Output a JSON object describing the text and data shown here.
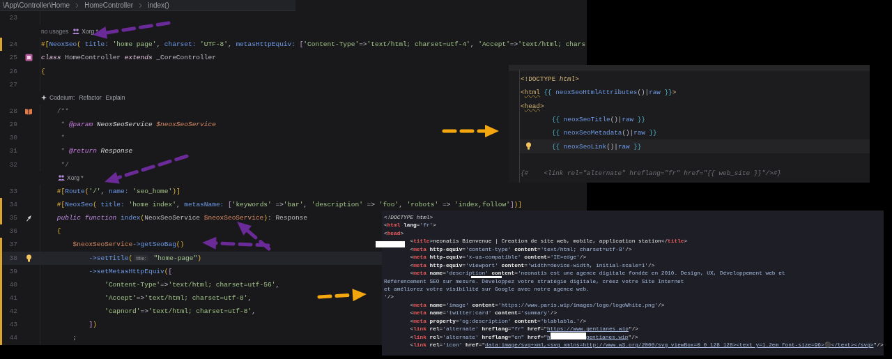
{
  "breadcrumbs": [
    "\\App\\Controller\\Home",
    "HomeController",
    "index()"
  ],
  "php_editor": {
    "rows": [
      {
        "kind": "code",
        "number": "23",
        "modified": false,
        "current": false,
        "tokens": []
      },
      {
        "kind": "lens",
        "indented": false,
        "items": [
          {
            "kind": "usages",
            "text": "no usages"
          },
          {
            "kind": "author",
            "text": "Xorg *"
          }
        ]
      },
      {
        "kind": "code",
        "number": "24",
        "modified": true,
        "current": false,
        "tokens": [
          {
            "kind": "bracket",
            "t": "#["
          },
          {
            "kind": "attr",
            "t": "NeoxSeo"
          },
          {
            "kind": "bracket",
            "t": "( "
          },
          {
            "kind": "named",
            "t": "title: "
          },
          {
            "kind": "string",
            "t": "'home page'"
          },
          {
            "kind": "punct",
            "t": ", "
          },
          {
            "kind": "named",
            "t": "charset: "
          },
          {
            "kind": "string",
            "t": "'UTF-8'"
          },
          {
            "kind": "punct",
            "t": ", "
          },
          {
            "kind": "named",
            "t": "metasHttpEquiv: "
          },
          {
            "kind": "bracket2",
            "t": "["
          },
          {
            "kind": "string",
            "t": "'Content-Type'"
          },
          {
            "kind": "punct",
            "t": "=>"
          },
          {
            "kind": "string",
            "t": "'text/html; charset=utf-4'"
          },
          {
            "kind": "punct",
            "t": ", "
          },
          {
            "kind": "string",
            "t": "'Accept'"
          },
          {
            "kind": "punct",
            "t": "=>"
          },
          {
            "kind": "string",
            "t": "'text/html; chars"
          }
        ]
      },
      {
        "kind": "class_decl",
        "number": "25",
        "modified": false,
        "current": false,
        "tokens": [
          {
            "kind": "decl",
            "t": "class"
          },
          {
            "kind": "plain",
            "t": " HomeController "
          },
          {
            "kind": "decl",
            "t": "extends"
          },
          {
            "kind": "plain",
            "t": " _CoreController"
          }
        ]
      },
      {
        "kind": "code",
        "number": "26",
        "modified": false,
        "current": false,
        "tokens": [
          {
            "kind": "bracket",
            "t": "{"
          }
        ]
      },
      {
        "kind": "code",
        "number": "27",
        "modified": false,
        "current": false,
        "tokens": []
      },
      {
        "kind": "lens",
        "indented": false,
        "items": [
          {
            "kind": "assistant",
            "text": "Codeium:"
          },
          {
            "kind": "action",
            "text": "Refactor"
          },
          {
            "kind": "action",
            "text": "Explain"
          }
        ]
      },
      {
        "kind": "doc_comment",
        "number": "28",
        "modified": false,
        "current": false,
        "tokens": [
          {
            "kind": "comment",
            "t": "    /**"
          }
        ]
      },
      {
        "kind": "code",
        "number": "29",
        "modified": false,
        "current": false,
        "tokens": [
          {
            "kind": "comment",
            "t": "     * "
          },
          {
            "kind": "doctag",
            "t": "@param"
          },
          {
            "kind": "doctype",
            "t": " NeoxSeoService "
          },
          {
            "kind": "docvar",
            "t": "$neoxSeoService"
          }
        ]
      },
      {
        "kind": "code",
        "number": "30",
        "modified": false,
        "current": false,
        "tokens": [
          {
            "kind": "comment",
            "t": "     *"
          }
        ]
      },
      {
        "kind": "code",
        "number": "31",
        "modified": false,
        "current": false,
        "tokens": [
          {
            "kind": "comment",
            "t": "     * "
          },
          {
            "kind": "doctag",
            "t": "@return"
          },
          {
            "kind": "doctype",
            "t": " Response"
          }
        ]
      },
      {
        "kind": "code",
        "number": "32",
        "modified": false,
        "current": false,
        "tokens": [
          {
            "kind": "comment",
            "t": "     */"
          }
        ]
      },
      {
        "kind": "lens",
        "indented": true,
        "items": [
          {
            "kind": "author",
            "text": "Xorg *"
          }
        ]
      },
      {
        "kind": "code",
        "number": "33",
        "modified": false,
        "current": false,
        "tokens": [
          {
            "kind": "bracket",
            "t": "    #["
          },
          {
            "kind": "attr",
            "t": "Route"
          },
          {
            "kind": "bracket",
            "t": "("
          },
          {
            "kind": "string",
            "t": "'/'"
          },
          {
            "kind": "punct",
            "t": ", "
          },
          {
            "kind": "named",
            "t": "name: "
          },
          {
            "kind": "string",
            "t": "'seo_home'"
          },
          {
            "kind": "bracket",
            "t": ")]"
          }
        ]
      },
      {
        "kind": "code",
        "number": "34",
        "modified": true,
        "current": false,
        "tokens": [
          {
            "kind": "bracket",
            "t": "    #["
          },
          {
            "kind": "attr",
            "t": "NeoxSeo"
          },
          {
            "kind": "bracket",
            "t": "( "
          },
          {
            "kind": "named",
            "t": "title: "
          },
          {
            "kind": "string",
            "t": "'home index'"
          },
          {
            "kind": "punct",
            "t": ", "
          },
          {
            "kind": "named",
            "t": "metasName: "
          },
          {
            "kind": "bracket2",
            "t": "["
          },
          {
            "kind": "string",
            "t": "'keywords'"
          },
          {
            "kind": "punct",
            "t": " =>"
          },
          {
            "kind": "string",
            "t": "'bar'"
          },
          {
            "kind": "punct",
            "t": ", "
          },
          {
            "kind": "string",
            "t": "'description'"
          },
          {
            "kind": "punct",
            "t": " => "
          },
          {
            "kind": "string",
            "t": "'foo'"
          },
          {
            "kind": "punct",
            "t": ", "
          },
          {
            "kind": "string",
            "t": "'robots'"
          },
          {
            "kind": "punct",
            "t": " => "
          },
          {
            "kind": "string",
            "t": "'index,follow'"
          },
          {
            "kind": "bracket2",
            "t": "]"
          },
          {
            "kind": "bracket",
            "t": ")]"
          }
        ]
      },
      {
        "kind": "method_decl",
        "number": "35",
        "modified": true,
        "current": false,
        "tokens": [
          {
            "kind": "keyword",
            "t": "    public function"
          },
          {
            "kind": "method",
            "t": " index"
          },
          {
            "kind": "bracket",
            "t": "("
          },
          {
            "kind": "plain",
            "t": "NeoxSeoService "
          },
          {
            "kind": "variable",
            "t": "$neoxSeoService"
          },
          {
            "kind": "bracket",
            "t": ")"
          },
          {
            "kind": "punct",
            "t": ": Response"
          }
        ]
      },
      {
        "kind": "code",
        "number": "36",
        "modified": false,
        "current": false,
        "tokens": [
          {
            "kind": "bracket",
            "t": "    {"
          }
        ]
      },
      {
        "kind": "code",
        "number": "37",
        "modified": true,
        "current": false,
        "tokens": [
          {
            "kind": "variable",
            "t": "        $neoxSeoService"
          },
          {
            "kind": "method",
            "t": "->getSeoBag"
          },
          {
            "kind": "bracket",
            "t": "()"
          }
        ]
      },
      {
        "kind": "intention",
        "number": "38",
        "modified": true,
        "current": true,
        "tokens": [
          {
            "kind": "method",
            "t": "            ->setTitle"
          },
          {
            "kind": "bracket",
            "t": "("
          },
          {
            "kind": "hint",
            "t": "title:"
          },
          {
            "kind": "string",
            "t": " \"home-page\""
          },
          {
            "kind": "bracket",
            "t": ")"
          }
        ]
      },
      {
        "kind": "code",
        "number": "39",
        "modified": true,
        "current": false,
        "tokens": [
          {
            "kind": "method",
            "t": "            ->setMetasHttpEquiv"
          },
          {
            "kind": "bracket",
            "t": "("
          },
          {
            "kind": "bracket2",
            "t": "["
          }
        ]
      },
      {
        "kind": "code",
        "number": "40",
        "modified": true,
        "current": false,
        "tokens": [
          {
            "kind": "string",
            "t": "                'Content-Type'"
          },
          {
            "kind": "punct",
            "t": "=>"
          },
          {
            "kind": "string",
            "t": "'text/html; charset=utf-56'"
          },
          {
            "kind": "punct",
            "t": ","
          }
        ]
      },
      {
        "kind": "code",
        "number": "41",
        "modified": true,
        "current": false,
        "tokens": [
          {
            "kind": "string",
            "t": "                'Accept'"
          },
          {
            "kind": "punct",
            "t": "=>"
          },
          {
            "kind": "string",
            "t": "'text/html; charset=utf-8'"
          },
          {
            "kind": "punct",
            "t": ","
          }
        ]
      },
      {
        "kind": "code",
        "number": "42",
        "modified": true,
        "current": false,
        "tokens": [
          {
            "kind": "string",
            "t": "                'capnord'"
          },
          {
            "kind": "punct",
            "t": "=>"
          },
          {
            "kind": "string",
            "t": "'text/html; charset=utf-8'"
          },
          {
            "kind": "punct",
            "t": ","
          }
        ]
      },
      {
        "kind": "code",
        "number": "43",
        "modified": true,
        "current": false,
        "tokens": [
          {
            "kind": "bracket2",
            "t": "            ]"
          },
          {
            "kind": "bracket",
            "t": ")"
          }
        ]
      },
      {
        "kind": "code",
        "number": "44",
        "modified": true,
        "current": false,
        "tokens": [
          {
            "kind": "punct",
            "t": "        ;"
          }
        ]
      }
    ]
  },
  "twig_editor": {
    "rows": [
      {
        "current": false,
        "bulb": false,
        "tokens": [
          {
            "kind": "tag",
            "t": "<!DOCTYPE "
          },
          {
            "kind": "tagitalic",
            "t": "html"
          },
          {
            "kind": "tag",
            "t": ">"
          }
        ]
      },
      {
        "current": false,
        "bulb": false,
        "tokens": [
          {
            "kind": "tag",
            "t": "<"
          },
          {
            "kind": "tagname",
            "t": "html"
          },
          {
            "kind": "twig",
            "t": " {{ "
          },
          {
            "kind": "func",
            "t": "neoxSeoHtmlAttributes"
          },
          {
            "kind": "punct",
            "t": "()|"
          },
          {
            "kind": "func",
            "t": "raw"
          },
          {
            "kind": "twig",
            "t": " }}"
          },
          {
            "kind": "tag",
            "t": ">"
          }
        ]
      },
      {
        "current": false,
        "bulb": false,
        "tokens": [
          {
            "kind": "tag",
            "t": "<"
          },
          {
            "kind": "tagname",
            "t": "head"
          },
          {
            "kind": "tag",
            "t": ">"
          }
        ]
      },
      {
        "kind": "nested",
        "current": false,
        "bulb": false,
        "tokens": [
          {
            "kind": "twig",
            "t": "{{ "
          },
          {
            "kind": "func",
            "t": "neoxSeoTitle"
          },
          {
            "kind": "punct",
            "t": "()|"
          },
          {
            "kind": "func",
            "t": "raw"
          },
          {
            "kind": "twig",
            "t": " }}"
          }
        ]
      },
      {
        "kind": "nested",
        "current": false,
        "bulb": false,
        "tokens": [
          {
            "kind": "twig",
            "t": "{{ "
          },
          {
            "kind": "func",
            "t": "neoxSeoMetadata"
          },
          {
            "kind": "punct",
            "t": "()|"
          },
          {
            "kind": "func",
            "t": "raw"
          },
          {
            "kind": "twig",
            "t": " }}"
          }
        ]
      },
      {
        "kind": "nested",
        "current": true,
        "bulb": true,
        "tokens": [
          {
            "kind": "twig",
            "t": "{{ "
          },
          {
            "kind": "func",
            "t": "neoxSeoLink"
          },
          {
            "kind": "punct",
            "t": "()|"
          },
          {
            "kind": "func",
            "t": "raw"
          },
          {
            "kind": "twig",
            "t": " }}"
          }
        ]
      },
      {
        "current": false,
        "bulb": false,
        "tokens": []
      },
      {
        "current": false,
        "bulb": false,
        "tokens": [
          {
            "kind": "comment",
            "t": "{#    <link rel=\"alternate\" hreflang=\"fr\" href=\"{{ web_site }}\"/>#}"
          }
        ]
      }
    ]
  },
  "html_source": {
    "rows": [
      {
        "tokens": [
          {
            "kind": "doc",
            "t": "<!DOCTYPE html>"
          }
        ]
      },
      {
        "tokens": [
          {
            "kind": "p",
            "t": "<"
          },
          {
            "kind": "tag",
            "t": "html"
          },
          {
            "kind": "attr",
            "t": " lang"
          },
          {
            "kind": "p",
            "t": "="
          },
          {
            "kind": "val",
            "t": "'fr'"
          },
          {
            "kind": "p",
            "t": ">"
          }
        ]
      },
      {
        "tokens": [
          {
            "kind": "p",
            "t": "<"
          },
          {
            "kind": "tag",
            "t": "head"
          },
          {
            "kind": "p",
            "t": ">"
          }
        ]
      },
      {
        "tokens": [
          {
            "kind": "p",
            "t": "        <"
          },
          {
            "kind": "tag",
            "t": "title"
          },
          {
            "kind": "p",
            "t": ">"
          },
          {
            "kind": "text",
            "t": "neonatis Bienvenue | Creation de site web, mobile, application station"
          },
          {
            "kind": "p",
            "t": "</"
          },
          {
            "kind": "tag",
            "t": "title"
          },
          {
            "kind": "p",
            "t": ">"
          }
        ]
      },
      {
        "tokens": [
          {
            "kind": "p",
            "t": "        <"
          },
          {
            "kind": "tag",
            "t": "meta"
          },
          {
            "kind": "attr",
            "t": " http-equiv"
          },
          {
            "kind": "p",
            "t": "="
          },
          {
            "kind": "val",
            "t": "'content-type'"
          },
          {
            "kind": "attr",
            "t": " content"
          },
          {
            "kind": "p",
            "t": "="
          },
          {
            "kind": "val",
            "t": "'text/html; charset=utf-8'"
          },
          {
            "kind": "p",
            "t": "/>"
          }
        ]
      },
      {
        "tokens": [
          {
            "kind": "p",
            "t": "        <"
          },
          {
            "kind": "tag",
            "t": "meta"
          },
          {
            "kind": "attr",
            "t": " http-equiv"
          },
          {
            "kind": "p",
            "t": "="
          },
          {
            "kind": "val",
            "t": "'x-ua-compatible'"
          },
          {
            "kind": "attr",
            "t": " content"
          },
          {
            "kind": "p",
            "t": "="
          },
          {
            "kind": "val",
            "t": "'IE=edge'"
          },
          {
            "kind": "p",
            "t": "/>"
          }
        ]
      },
      {
        "tokens": [
          {
            "kind": "p",
            "t": "        <"
          },
          {
            "kind": "tag",
            "t": "meta"
          },
          {
            "kind": "attr",
            "t": " http-equiv"
          },
          {
            "kind": "p",
            "t": "="
          },
          {
            "kind": "val",
            "t": "'viewport'"
          },
          {
            "kind": "attr",
            "t": " content"
          },
          {
            "kind": "p",
            "t": "="
          },
          {
            "kind": "val",
            "t": "'width=device-width, initial-scale=1'"
          },
          {
            "kind": "p",
            "t": "/>"
          }
        ]
      },
      {
        "tokens": [
          {
            "kind": "p",
            "t": "        <"
          },
          {
            "kind": "tag",
            "t": "meta"
          },
          {
            "kind": "attr",
            "t": " name"
          },
          {
            "kind": "p",
            "t": "="
          },
          {
            "kind": "val",
            "t": "'description'"
          },
          {
            "kind": "attr",
            "t": " content"
          },
          {
            "kind": "p",
            "t": "="
          },
          {
            "kind": "val",
            "t": "'neonatis est une agence digitale fondée en 2010. Design, UX, Développement web et"
          }
        ]
      },
      {
        "tokens": [
          {
            "kind": "val",
            "t": "Référencement SEO sur mesure. Développez votre stratégie digitale, créez votre Site Internet"
          }
        ]
      },
      {
        "tokens": [
          {
            "kind": "val",
            "t": "et améliorez votre visibilité sur Google avec notre agence web."
          }
        ]
      },
      {
        "tokens": [
          {
            "kind": "val",
            "t": "'"
          },
          {
            "kind": "p",
            "t": "/>"
          }
        ]
      },
      {
        "tokens": [
          {
            "kind": "p",
            "t": "        <"
          },
          {
            "kind": "tag",
            "t": "meta"
          },
          {
            "kind": "attr",
            "t": " name"
          },
          {
            "kind": "p",
            "t": "="
          },
          {
            "kind": "val",
            "t": "'image'"
          },
          {
            "kind": "attr",
            "t": " content"
          },
          {
            "kind": "p",
            "t": "="
          },
          {
            "kind": "val",
            "t": "'https://www.paris.wip/images/logo/logoWhite.png'"
          },
          {
            "kind": "p",
            "t": "/>"
          }
        ]
      },
      {
        "tokens": [
          {
            "kind": "p",
            "t": "        <"
          },
          {
            "kind": "tag",
            "t": "meta"
          },
          {
            "kind": "attr",
            "t": " name"
          },
          {
            "kind": "p",
            "t": "="
          },
          {
            "kind": "val",
            "t": "'twitter:card'"
          },
          {
            "kind": "attr",
            "t": " content"
          },
          {
            "kind": "p",
            "t": "="
          },
          {
            "kind": "val",
            "t": "'summary'"
          },
          {
            "kind": "p",
            "t": "/>"
          }
        ]
      },
      {
        "tokens": [
          {
            "kind": "p",
            "t": "        <"
          },
          {
            "kind": "tag",
            "t": "meta"
          },
          {
            "kind": "attr",
            "t": " property"
          },
          {
            "kind": "p",
            "t": "="
          },
          {
            "kind": "val",
            "t": "'og:description'"
          },
          {
            "kind": "attr",
            "t": " content"
          },
          {
            "kind": "p",
            "t": "="
          },
          {
            "kind": "val",
            "t": "'blablabla.'"
          },
          {
            "kind": "p",
            "t": "/>"
          }
        ]
      },
      {
        "tokens": [
          {
            "kind": "p",
            "t": "        <"
          },
          {
            "kind": "tag",
            "t": "link"
          },
          {
            "kind": "attr",
            "t": " rel"
          },
          {
            "kind": "p",
            "t": "="
          },
          {
            "kind": "val",
            "t": "'alternate'"
          },
          {
            "kind": "attr",
            "t": " hreflang"
          },
          {
            "kind": "p",
            "t": "="
          },
          {
            "kind": "val",
            "t": "\"fr\""
          },
          {
            "kind": "attr",
            "t": " href"
          },
          {
            "kind": "p",
            "t": "=\""
          },
          {
            "kind": "link",
            "t": "https://www.gentianes.wip"
          },
          {
            "kind": "p",
            "t": "\"/>"
          }
        ]
      },
      {
        "tokens": [
          {
            "kind": "p",
            "t": "        <"
          },
          {
            "kind": "tag",
            "t": "link"
          },
          {
            "kind": "attr",
            "t": " rel"
          },
          {
            "kind": "p",
            "t": "="
          },
          {
            "kind": "val",
            "t": "'alternate'"
          },
          {
            "kind": "attr",
            "t": " hreflang"
          },
          {
            "kind": "p",
            "t": "="
          },
          {
            "kind": "val",
            "t": "\"en\""
          },
          {
            "kind": "attr",
            "t": " href"
          },
          {
            "kind": "p",
            "t": "=\""
          },
          {
            "kind": "link",
            "t": "h"
          },
          {
            "kind": "redacted"
          },
          {
            "kind": "link",
            "t": "gentianes.wip"
          },
          {
            "kind": "p",
            "t": "\"/>"
          }
        ]
      },
      {
        "tokens": [
          {
            "kind": "p",
            "t": "        <"
          },
          {
            "kind": "tag",
            "t": "link"
          },
          {
            "kind": "attr",
            "t": " rel"
          },
          {
            "kind": "p",
            "t": "="
          },
          {
            "kind": "val",
            "t": "'icon'"
          },
          {
            "kind": "attr",
            "t": " href"
          },
          {
            "kind": "p",
            "t": "=\""
          },
          {
            "kind": "link",
            "t": "data:image/svg+xml,<svg xmlns=http://www.w3.org/2000/svg viewBox=0 0 128 128><text y=1.2em font-size=96>⚫</text></svg>"
          },
          {
            "kind": "p",
            "t": "\"/>"
          }
        ]
      }
    ]
  }
}
